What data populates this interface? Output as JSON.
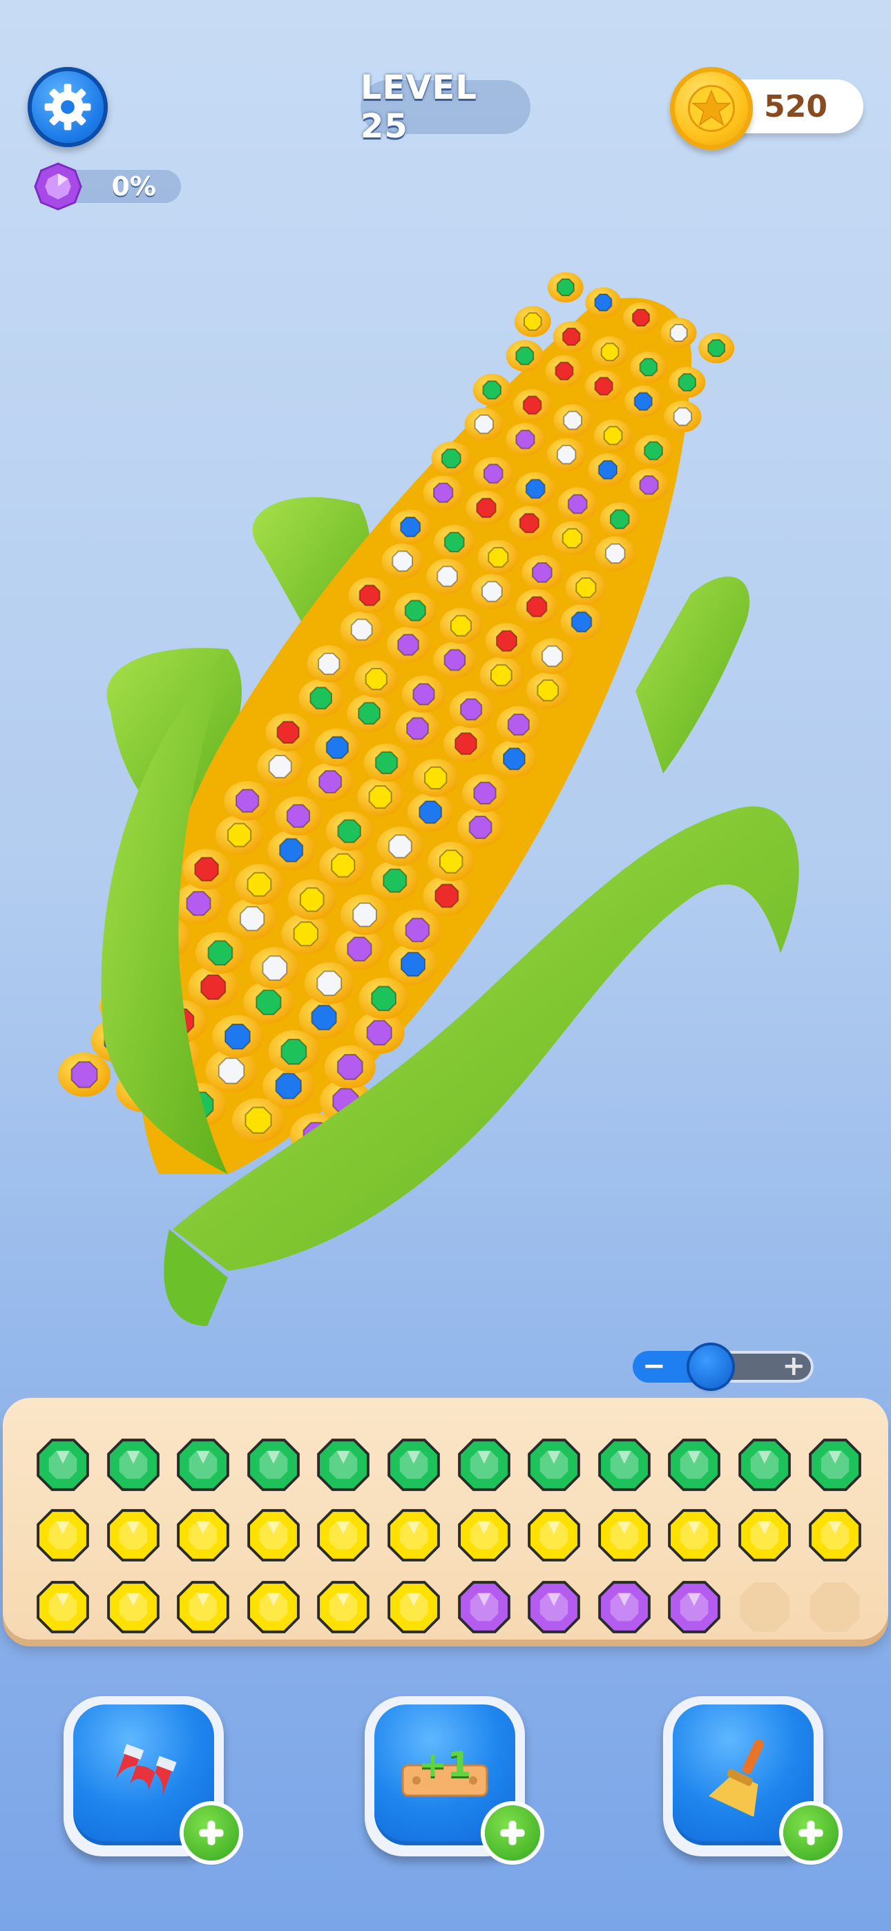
{
  "hud": {
    "level_label": "LEVEL 25",
    "coins": "520",
    "progress": "0%",
    "progress_fraction": 0.0
  },
  "icons": {
    "settings": "gear-icon",
    "coin": "star-coin-icon",
    "gem": "purple-gem-icon"
  },
  "slider": {
    "level": 0.28
  },
  "gem_colors": {
    "green": "#1ec25a",
    "yellow": "#ffe100",
    "purple": "#b45cf0",
    "blue": "#1e78f0",
    "red": "#ee2b2b",
    "white": "#f4f6fa"
  },
  "tray": {
    "rows": [
      [
        "green",
        "green",
        "green",
        "green",
        "green",
        "green",
        "green",
        "green",
        "green",
        "green",
        "green",
        "green"
      ],
      [
        "yellow",
        "yellow",
        "yellow",
        "yellow",
        "yellow",
        "yellow",
        "yellow",
        "yellow",
        "yellow",
        "yellow",
        "yellow",
        "yellow"
      ],
      [
        "yellow",
        "yellow",
        "yellow",
        "yellow",
        "yellow",
        "yellow",
        "purple",
        "purple",
        "purple",
        "purple",
        "empty",
        "empty"
      ]
    ]
  },
  "boosters": [
    {
      "name": "magnet",
      "icon": "magnet-icon"
    },
    {
      "name": "add-slot",
      "icon": "plus-one-slot-icon",
      "label": "+1"
    },
    {
      "name": "sweep",
      "icon": "broom-icon"
    }
  ]
}
